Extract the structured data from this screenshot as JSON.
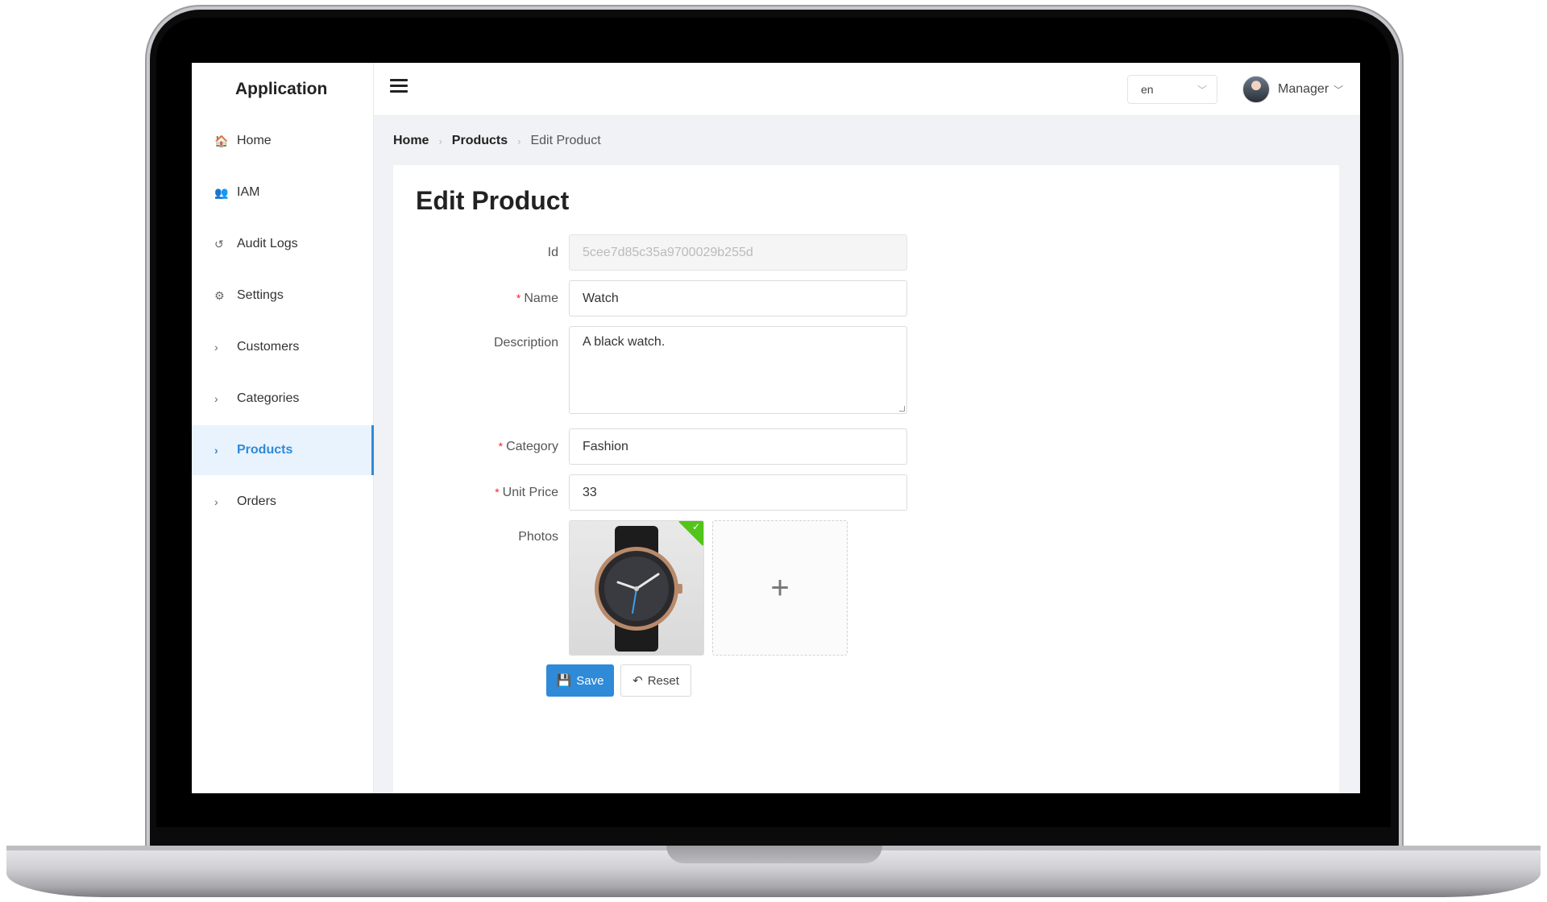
{
  "app": {
    "title": "Application"
  },
  "sidebar": {
    "items": [
      {
        "label": "Home",
        "icon": "home-icon",
        "glyph": "🏠"
      },
      {
        "label": "IAM",
        "icon": "users-icon",
        "glyph": "👥"
      },
      {
        "label": "Audit Logs",
        "icon": "history-icon",
        "glyph": "↺"
      },
      {
        "label": "Settings",
        "icon": "gear-icon",
        "glyph": "⚙"
      },
      {
        "label": "Customers",
        "icon": "chevron-right-icon",
        "glyph": "›"
      },
      {
        "label": "Categories",
        "icon": "chevron-right-icon",
        "glyph": "›"
      },
      {
        "label": "Products",
        "icon": "chevron-right-icon",
        "glyph": "›"
      },
      {
        "label": "Orders",
        "icon": "chevron-right-icon",
        "glyph": "›"
      }
    ],
    "active_item": "Products",
    "accent_color": "#2f8ad8"
  },
  "header": {
    "language": "en",
    "user": "Manager"
  },
  "breadcrumb": {
    "home": "Home",
    "section": "Products",
    "current": "Edit Product"
  },
  "form": {
    "title": "Edit Product",
    "id_label": "Id",
    "id_value": "5cee7d85c35a9700029b255d",
    "name_label": "Name",
    "name_value": "Watch",
    "description_label": "Description",
    "description_value": "A black watch.",
    "category_label": "Category",
    "category_value": "Fashion",
    "unit_price_label": "Unit Price",
    "unit_price_value": "33",
    "photos_label": "Photos",
    "required_mark": "*",
    "save_label": "Save",
    "reset_label": "Reset"
  }
}
